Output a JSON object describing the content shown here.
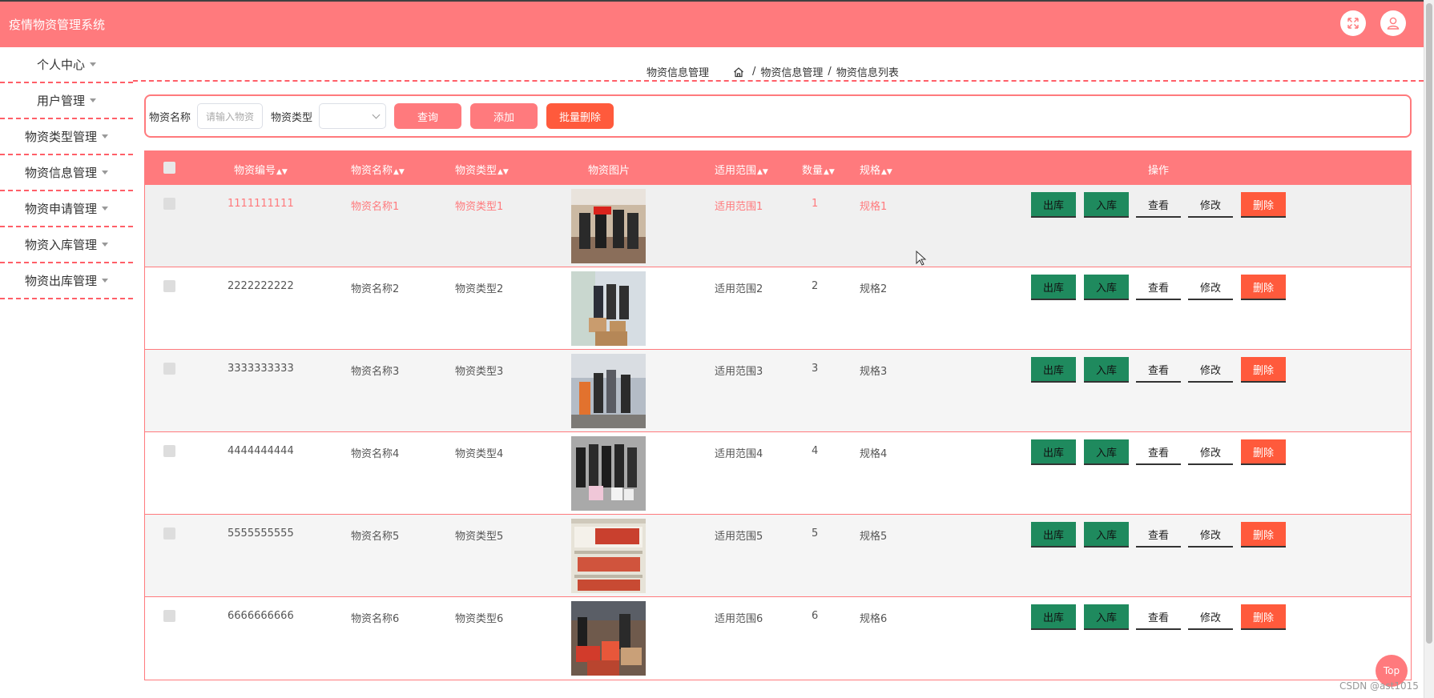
{
  "header": {
    "title": "疫情物资管理系统",
    "fullscreen_icon": "expand-icon",
    "user_icon": "user-icon"
  },
  "sidebar": {
    "items": [
      {
        "label": "个人中心"
      },
      {
        "label": "用户管理"
      },
      {
        "label": "物资类型管理"
      },
      {
        "label": "物资信息管理"
      },
      {
        "label": "物资申请管理"
      },
      {
        "label": "物资入库管理"
      },
      {
        "label": "物资出库管理"
      }
    ]
  },
  "breadcrumb": {
    "current": "物资信息管理",
    "path": [
      "物资信息管理",
      "物资信息列表"
    ],
    "separator": "/"
  },
  "search": {
    "name_label": "物资名称",
    "name_placeholder": "请输入物资",
    "type_label": "物资类型",
    "type_value": "",
    "query_label": "查询",
    "add_label": "添加",
    "batch_delete_label": "批量删除"
  },
  "table": {
    "columns": [
      "物资编号",
      "物资名称",
      "物资类型",
      "物资图片",
      "适用范围",
      "数量",
      "规格",
      "操作"
    ],
    "actions": [
      "出库",
      "入库",
      "查看",
      "修改",
      "删除"
    ],
    "rows": [
      {
        "code": "1111111111",
        "name": "物资名称1",
        "type": "物资类型1",
        "scope": "适用范围1",
        "qty": "1",
        "spec": "规格1"
      },
      {
        "code": "2222222222",
        "name": "物资名称2",
        "type": "物资类型2",
        "scope": "适用范围2",
        "qty": "2",
        "spec": "规格2"
      },
      {
        "code": "3333333333",
        "name": "物资名称3",
        "type": "物资类型3",
        "scope": "适用范围3",
        "qty": "3",
        "spec": "规格3"
      },
      {
        "code": "4444444444",
        "name": "物资名称4",
        "type": "物资类型4",
        "scope": "适用范围4",
        "qty": "4",
        "spec": "规格4"
      },
      {
        "code": "5555555555",
        "name": "物资名称5",
        "type": "物资类型5",
        "scope": "适用范围5",
        "qty": "5",
        "spec": "规格5"
      },
      {
        "code": "6666666666",
        "name": "物资名称6",
        "type": "物资类型6",
        "scope": "适用范围6",
        "qty": "6",
        "spec": "规格6"
      }
    ]
  },
  "top_button": "Top",
  "watermark": "CSDN @ast1015",
  "colors": {
    "primary": "#ff7a7d",
    "danger": "#ff5a3c",
    "green": "#1f8a5e"
  }
}
